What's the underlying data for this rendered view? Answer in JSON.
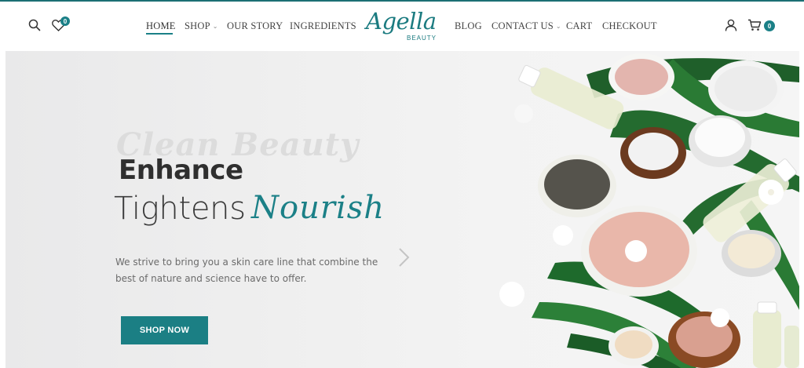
{
  "header": {
    "wishlist_count": "0",
    "cart_count": "0",
    "nav_left": [
      {
        "label": "HOME",
        "active": true
      },
      {
        "label": "SHOP",
        "dropdown": true
      },
      {
        "label": "OUR STORY"
      },
      {
        "label": "INGREDIENTS"
      }
    ],
    "nav_right": [
      {
        "label": "BLOG"
      },
      {
        "label": "CONTACT US",
        "dropdown": true
      },
      {
        "label": "CART"
      },
      {
        "label": "CHECKOUT"
      }
    ],
    "logo": {
      "script": "Agella",
      "sub": "BEAUTY"
    }
  },
  "hero": {
    "background_script": "Clean Beauty",
    "heading_line1": "Enhance",
    "heading_line2_plain": "Tightens",
    "heading_line2_script": "Nourish",
    "description_line1": "We strive to bring you a skin care line that combine the",
    "description_line2": "best of nature and science have to offer.",
    "cta_label": "SHOP NOW"
  },
  "colors": {
    "accent": "#1b8087",
    "top_line": "#1b6f74",
    "button": "#1b7f84",
    "hero_bg": "#efefef"
  },
  "icons": [
    "search-icon",
    "heart-icon",
    "user-icon",
    "cart-icon",
    "chevron-right-icon",
    "chevron-down-icon"
  ]
}
